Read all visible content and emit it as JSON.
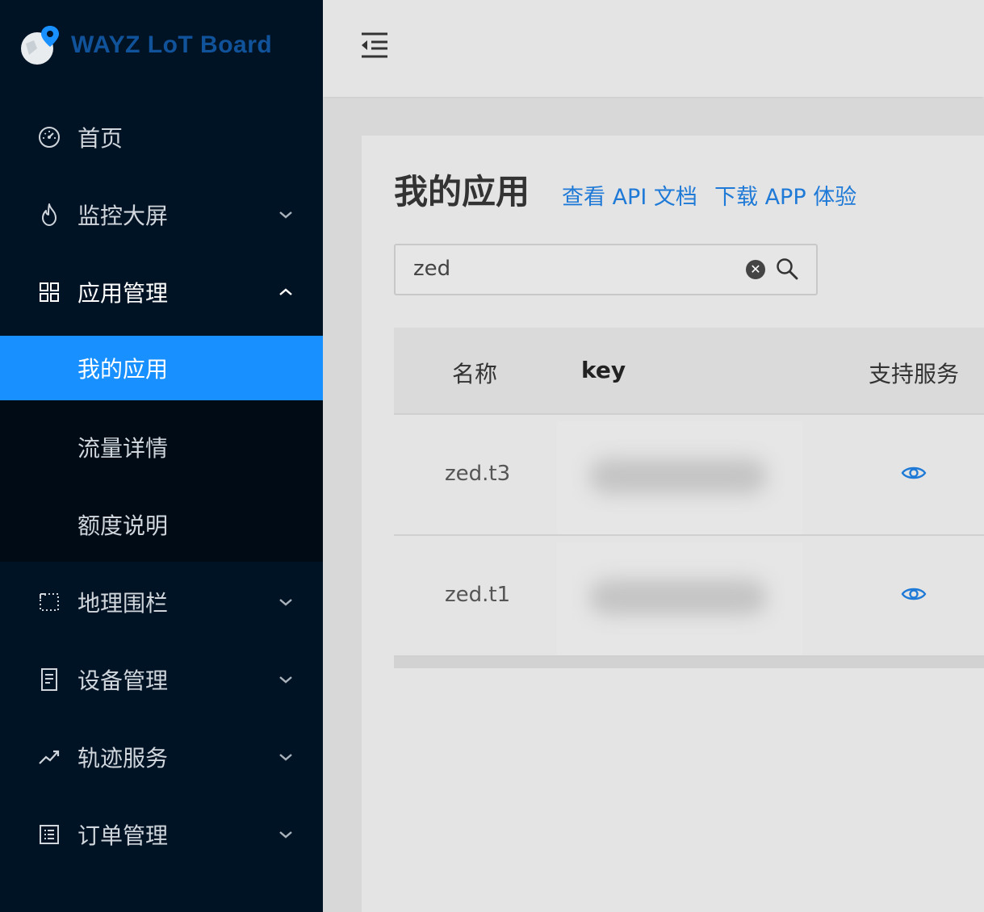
{
  "brand": {
    "name": "WAYZ LoT Board",
    "color": "#11539a"
  },
  "sidebar": {
    "items": [
      {
        "label": "首页",
        "icon": "dashboard-icon"
      },
      {
        "label": "监控大屏",
        "icon": "fire-icon"
      },
      {
        "label": "应用管理",
        "icon": "apps-grid-icon",
        "expanded": true,
        "children": [
          {
            "label": "我的应用",
            "active": true
          },
          {
            "label": "流量详情"
          },
          {
            "label": "额度说明"
          }
        ]
      },
      {
        "label": "地理围栏",
        "icon": "fence-icon"
      },
      {
        "label": "设备管理",
        "icon": "device-icon"
      },
      {
        "label": "轨迹服务",
        "icon": "trend-icon"
      },
      {
        "label": "订单管理",
        "icon": "order-list-icon"
      }
    ]
  },
  "header": {
    "toggle_icon": "menu-fold-icon"
  },
  "page": {
    "title": "我的应用",
    "links": {
      "api_docs": "查看 API 文档",
      "download_app": "下载 APP 体验"
    },
    "search": {
      "value": "zed"
    },
    "table": {
      "columns": {
        "name": "名称",
        "key": "key",
        "services": "支持服务"
      },
      "rows": [
        {
          "name": "zed.t3",
          "key": "",
          "services_icon": "eye-icon"
        },
        {
          "name": "zed.t1",
          "key": "",
          "services_icon": "eye-icon"
        }
      ]
    }
  },
  "colors": {
    "sidebar_bg": "#001325",
    "active_item": "#1890ff",
    "link": "#1f7ad7"
  }
}
